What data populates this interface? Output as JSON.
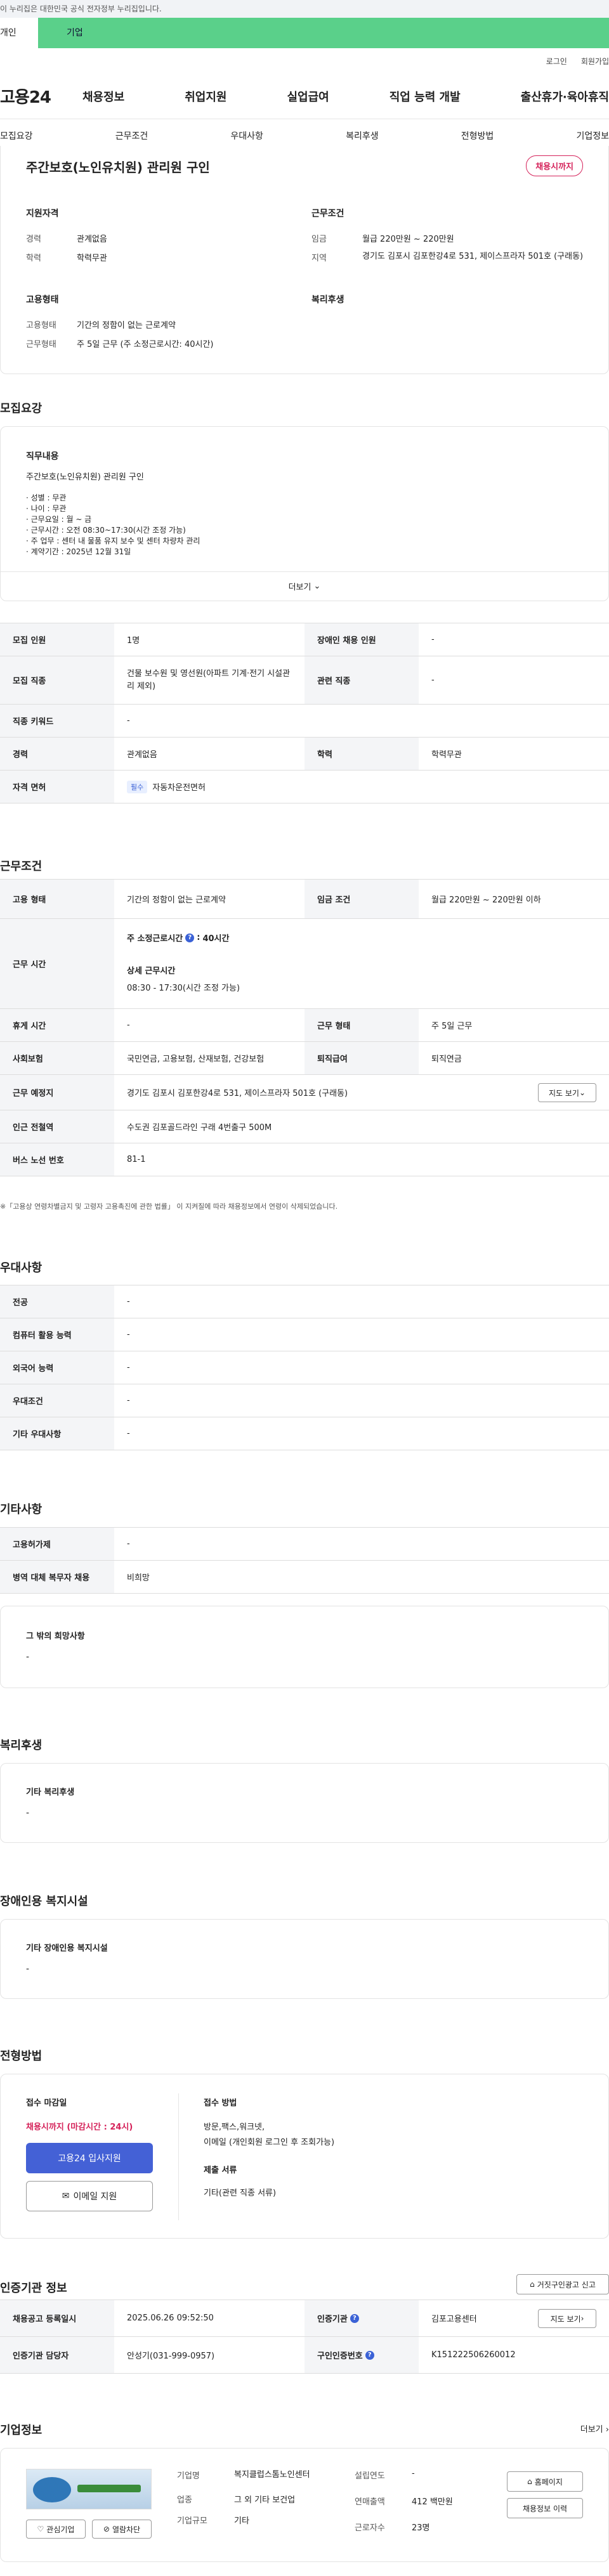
{
  "gov_banner": "이 누리집은 대한민국 공식 전자정부 누리집입니다.",
  "top_tabs": [
    "개인",
    "기업"
  ],
  "util": [
    "로그인",
    "회원가입"
  ],
  "logo": "고용24",
  "gnb": [
    "채용정보",
    "취업지원",
    "실업급여",
    "직업 능력 개발",
    "출산휴가·육아휴직"
  ],
  "subnav": [
    "모집요강",
    "근무조건",
    "우대사항",
    "복리후생",
    "전형방법",
    "기업정보"
  ],
  "job": {
    "title": "주간보호(노인유치원) 관리원 구인",
    "badge": "채용시까지"
  },
  "summary": {
    "qual_title": "지원자격",
    "cond_title": "근무조건",
    "emp_title": "고용형태",
    "welfare_title": "복리후생",
    "career_l": "경력",
    "career_v": "관계없음",
    "edu_l": "학력",
    "edu_v": "학력무관",
    "wage_l": "임금",
    "wage_v": "월급 220만원 ~ 220만원",
    "region_l": "지역",
    "region_v": "경기도 김포시 김포한강4로 531, 제이스프라자 501호 (구래동)",
    "emptype_l": "고용형태",
    "emptype_v": "기간의 정함이 없는 근로계약",
    "worktype_l": "근무형태",
    "worktype_v": "주 5일 근무 (주 소정근로시간: 40시간)"
  },
  "recruit": {
    "section": "모집요강",
    "duty_title": "직무내용",
    "duty_head": "주간보호(노인유치원) 관리원 구인",
    "duty_lines": [
      "· 성별 : 무관",
      "· 나이 : 무관",
      "· 근무요일 : 월 ~ 금",
      "· 근무시간 : 오전 08:30~17:30(시간 조정 가능)",
      "· 주 업무 : 센터 내 물품 유지 보수 및 센터 차량차 관리",
      "· 계약기간 : 2025년 12월 31일"
    ],
    "more": "더보기",
    "rows": {
      "headcount_l": "모집 인원",
      "headcount_v": "1명",
      "disabled_l": "장애인 채용 인원",
      "disabled_v": "-",
      "job_l": "모집 직종",
      "job_v": "건물 보수원 및 영선원(아파트 기계·전기 시설관리 제외)",
      "rel_l": "관련 직종",
      "rel_v": "-",
      "kw_l": "직종 키워드",
      "kw_v": "-",
      "career_l": "경력",
      "career_v": "관계없음",
      "edu_l": "학력",
      "edu_v": "학력무관",
      "lic_l": "자격 면허",
      "lic_tag": "필수",
      "lic_v": "자동차운전면허"
    }
  },
  "conditions": {
    "section": "근무조건",
    "emp_l": "고용 형태",
    "emp_v": "기간의 정함이 없는 근로계약",
    "wage_l": "임금 조건",
    "wage_v": "월급 220만원 ~ 220만원 이하",
    "hours_l": "근무 시간",
    "weekly_l": "주 소정근로시간",
    "weekly_v": "40시간",
    "detail_l": "상세 근무시간",
    "detail_v": "08:30 - 17:30(시간 조정 가능)",
    "break_l": "휴게 시간",
    "break_v": "-",
    "shape_l": "근무 형태",
    "shape_v": "주 5일 근무",
    "ins_l": "사회보험",
    "ins_v": "국민연금, 고용보험, 산재보험, 건강보험",
    "ret_l": "퇴직급여",
    "ret_v": "퇴직연금",
    "place_l": "근무 예정지",
    "place_v": "경기도 김포시 김포한강4로 531, 제이스프라자 501호 (구래동)",
    "map_btn": "지도 보기",
    "subway_l": "인근 전철역",
    "subway_v": "수도권 김포골드라인 구래 4번출구 500M",
    "bus_l": "버스 노선 번호",
    "bus_v": "81-1",
    "note": "※「고용상 연령차별금지 및 고령자 고용촉진에 관한 법률」 이 지켜질에 따라 채용정보에서 연령이 삭제되었습니다."
  },
  "prefer": {
    "section": "우대사항",
    "rows": [
      [
        "전공",
        "-"
      ],
      [
        "컴퓨터 활용 능력",
        "-"
      ],
      [
        "외국어 능력",
        "-"
      ],
      [
        "우대조건",
        "-"
      ],
      [
        "기타 우대사항",
        "-"
      ]
    ]
  },
  "etc": {
    "section": "기타사항",
    "rows": [
      [
        "고용허가제",
        "-"
      ],
      [
        "병역 대체 복무자 채용",
        "비희망"
      ]
    ],
    "wish_title": "그 밖의 희망사항",
    "wish_v": "-"
  },
  "welfare": {
    "section": "복리후생",
    "title": "기타 복리후생",
    "v": "-"
  },
  "facility": {
    "section": "장애인용 복지시설",
    "title": "기타 장애인용 복지시설",
    "v": "-"
  },
  "process": {
    "section": "전형방법",
    "deadline_title": "접수 마감일",
    "deadline_v": "채용시까지 (마감시간 : 24시)",
    "apply_btn": "고용24 입사지원",
    "email_btn": "이메일 지원",
    "method_title": "접수 방법",
    "method_v1": "방문,팩스,워크넷,",
    "method_v2": "이메일 (개인회원 로그인 후 조회가능)",
    "docs_title": "제출 서류",
    "docs_v": "기타(관련 직종 서류)"
  },
  "agency": {
    "section": "인증기관 정보",
    "report_btn": "거짓구인광고 신고",
    "reg_l": "채용공고 등록일시",
    "reg_v": "2025.06.26 09:52:50",
    "agency_l": "인증기관",
    "agency_v": "김포고용센터",
    "map_btn": "지도 보기",
    "mgr_l": "인증기관 담당자",
    "mgr_v": "안성기(031-999-0957)",
    "no_l": "구인인증번호",
    "no_v": "K151222506260012"
  },
  "company": {
    "section": "기업정보",
    "more": "더보기",
    "fav": "관심기업",
    "block": "열람차단",
    "name_l": "기업명",
    "name_v": "복지클럽스톰노인센터",
    "ind_l": "업종",
    "ind_v": "그 외 기타 보건업",
    "scale_l": "기업규모",
    "scale_v": "기타",
    "est_l": "설립연도",
    "est_v": "-",
    "sales_l": "연매출액",
    "sales_v": "412 백만원",
    "emp_l": "근로자수",
    "emp_v": "23명",
    "home_btn": "홈페이지",
    "view_btn": "채용정보 이력"
  }
}
